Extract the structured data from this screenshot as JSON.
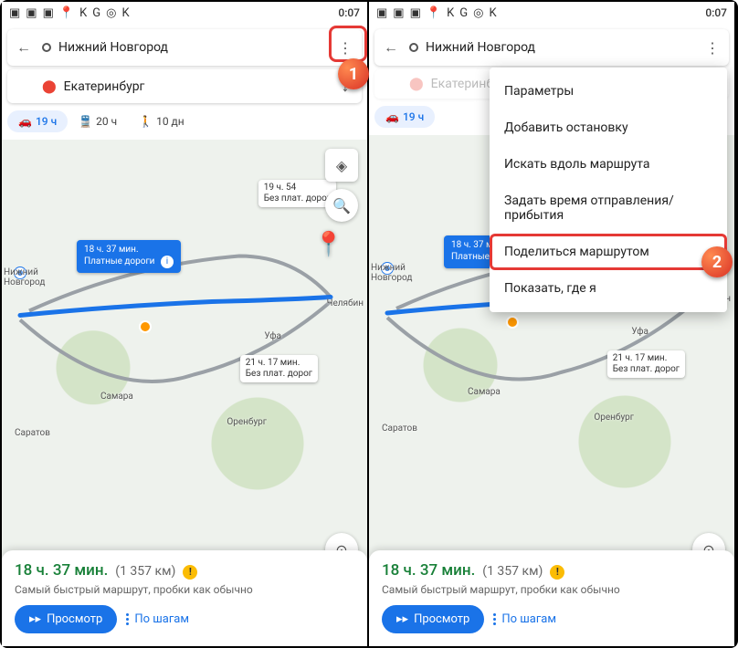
{
  "status": {
    "clock": "0:07"
  },
  "search": {
    "origin": "Нижний Новгород",
    "destination": "Екатеринбург"
  },
  "modes": {
    "car": "19 ч",
    "transit": "20 ч",
    "walk": "10 дн"
  },
  "map": {
    "labels": {
      "primary_time": "18 ч. 37 мин.",
      "primary_sub": "Платные дороги",
      "alt1_time": "19 ч. 54",
      "alt1_sub": "Без плат. дорог",
      "alt2_time": "21 ч. 17 мин.",
      "alt2_sub": "Без плат. дорог"
    },
    "cities": {
      "nn": "Нижний\nНовгород",
      "chel": "Челябин",
      "ufa": "Уфа",
      "samara": "Самара",
      "orenburg": "Оренбург",
      "saratov": "Саратов"
    }
  },
  "summary": {
    "duration": "18 ч. 37 мин.",
    "distance": "(1 357 км)",
    "subtitle": "Самый быстрый маршрут, пробки как обычно",
    "preview_btn": "Просмотр",
    "steps_btn": "По шагам"
  },
  "menu": {
    "params": "Параметры",
    "add_stop": "Добавить остановку",
    "search_along": "Искать вдоль маршрута",
    "set_time": "Задать время отправления/прибытия",
    "share": "Поделиться маршрутом",
    "show_me": "Показать, где я"
  },
  "callouts": {
    "one": "1",
    "two": "2"
  }
}
